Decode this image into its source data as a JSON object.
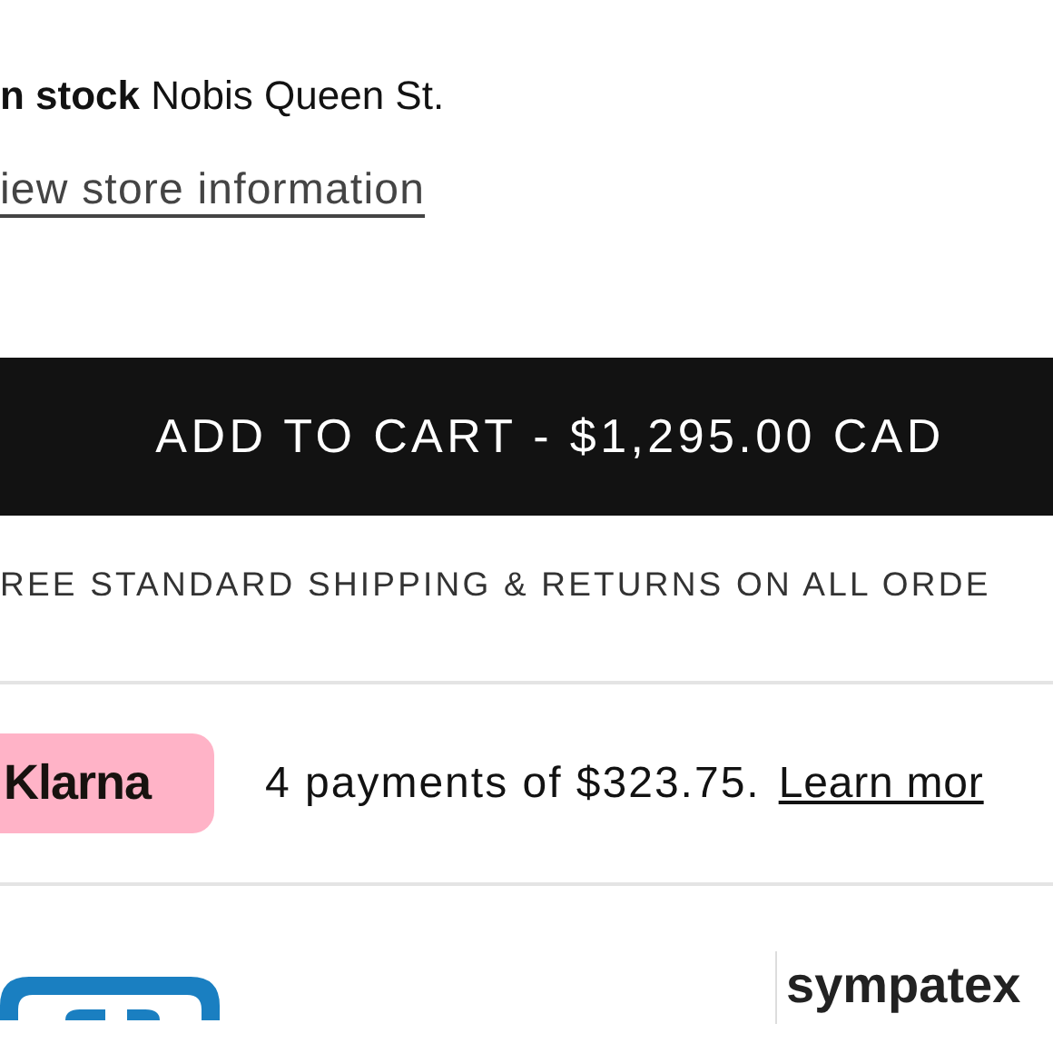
{
  "stock": {
    "text": "**n stock** Nobis Queen St."
  },
  "store_link": "iew store information",
  "add_to_cart": "ADD TO CART - $1,295.00 CAD",
  "shipping_note": "REE STANDARD SHIPPING & RETURNS ON ALL ORDE",
  "klarna": {
    "badge": "Klarna",
    "text": "4 payments of $323.75.",
    "link": "Learn mor"
  },
  "brand_logo": "sympatex"
}
